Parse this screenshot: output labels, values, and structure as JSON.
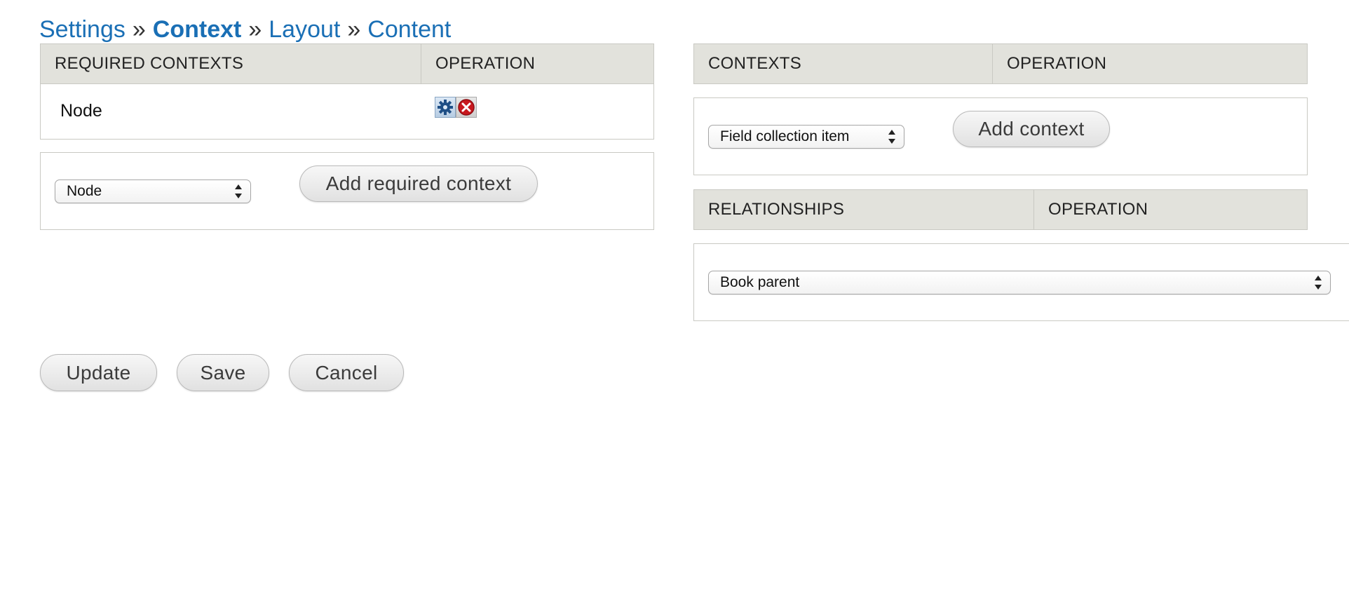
{
  "breadcrumb": {
    "items": [
      "Settings",
      "Context",
      "Layout",
      "Content"
    ],
    "separator": "»",
    "current": "Context"
  },
  "required_contexts": {
    "headers": [
      "REQUIRED CONTEXTS",
      "OPERATION"
    ],
    "rows": [
      {
        "name": "Node",
        "operations": [
          "settings-icon",
          "delete-icon"
        ]
      }
    ],
    "select_value": "Node",
    "add_button": "Add required context"
  },
  "contexts": {
    "headers": [
      "CONTEXTS",
      "OPERATION"
    ],
    "select_value": "Field collection item",
    "add_button": "Add context"
  },
  "relationships": {
    "headers": [
      "RELATIONSHIPS",
      "OPERATION"
    ],
    "select_value": "Book parent"
  },
  "actions": {
    "update": "Update",
    "save": "Save",
    "cancel": "Cancel"
  },
  "colors": {
    "link": "#1a6fb5",
    "header_bg": "#e2e2dc",
    "border": "#c9c9c3",
    "delete_red": "#c8181e"
  }
}
